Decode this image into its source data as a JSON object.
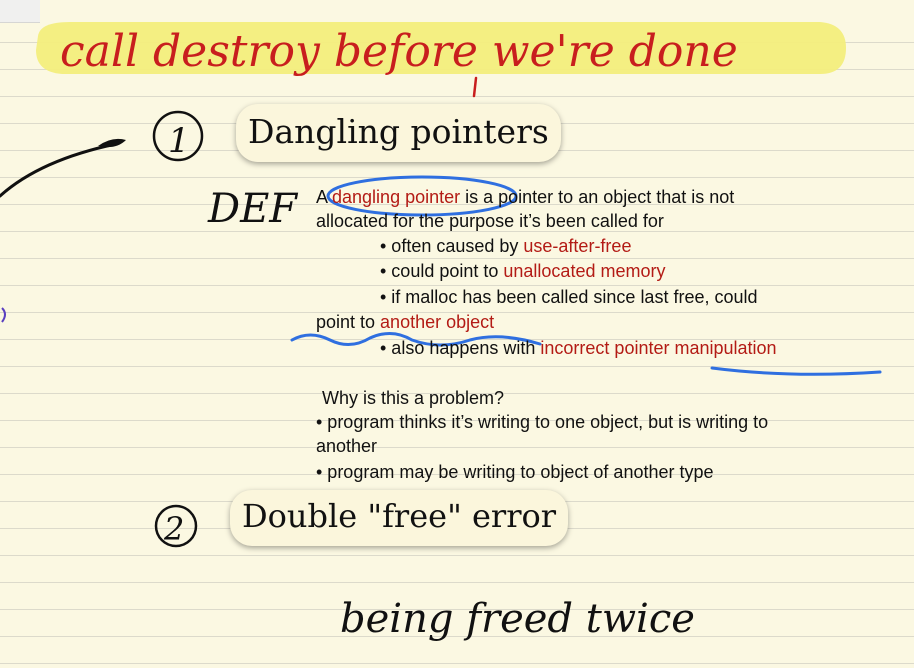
{
  "handwriting": {
    "title": "call destroy before we're done",
    "number_one": "1",
    "def_mark": "DEF",
    "number_two": "2",
    "footer": "being freed twice"
  },
  "sections": {
    "heading_1": "Dangling pointers",
    "heading_2": "Double \"free\" error"
  },
  "definition": {
    "lead_a": "A ",
    "term": "dangling pointer",
    "rest_1": " is a pointer to an object that is not",
    "line_2": "allocated for the purpose it’s been called for",
    "b1_prefix": "• often caused by ",
    "b1_red": "use-after-free",
    "b2_prefix": "• could point to ",
    "b2_red": "unallocated memory",
    "b3_text": "• if malloc has been called since last free, could",
    "b3_cont_prefix": "point to ",
    "b3_red": "another object",
    "b4_prefix": "• also happens with ",
    "b4_red": "incorrect pointer manipulation"
  },
  "problem": {
    "question": "Why is this a problem?",
    "p1_line1": "• program thinks it’s writing to one object, but is writing to",
    "p1_line2": "another",
    "p2": "• program may be writing to object of another type"
  },
  "colors": {
    "paper": "#fbf8e2",
    "highlighter": "#f3ee7c",
    "red_ink": "#c81e1e",
    "blue_ink": "#2f6fe0",
    "black_ink": "#111111",
    "accent_red_text": "#b31b15"
  }
}
